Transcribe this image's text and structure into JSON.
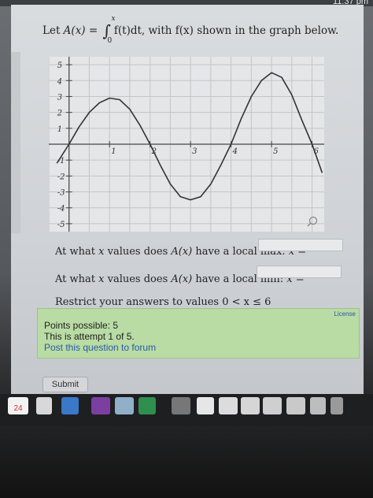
{
  "clock": "11:37 pm",
  "question": {
    "prefix": "Let ",
    "lhs": "A(x) = ",
    "int_upper": "x",
    "int_lower": "0",
    "integrand": "f(t)dt",
    "suffix": ", with f(x) shown in the graph below."
  },
  "chart_data": {
    "type": "line",
    "x_ticks": [
      "1",
      "2",
      "3",
      "4",
      "5",
      "6"
    ],
    "y_ticks": [
      "5",
      "4",
      "3",
      "2",
      "1",
      "-1",
      "-2",
      "-3",
      "-4",
      "-5"
    ],
    "xlim": [
      -0.5,
      6.3
    ],
    "ylim": [
      -5.5,
      5.5
    ],
    "grid": true,
    "series": [
      {
        "x": [
          -0.3,
          0,
          0.25,
          0.5,
          0.75,
          1,
          1.25,
          1.5,
          1.75,
          2,
          2.25,
          2.5,
          2.75,
          3,
          3.25,
          3.5,
          3.75,
          4,
          4.25,
          4.5,
          4.75,
          5,
          5.25,
          5.5,
          5.75,
          6,
          6.25
        ],
        "y": [
          -1.2,
          0,
          1.1,
          2,
          2.6,
          2.9,
          2.8,
          2.2,
          1.2,
          0,
          -1.3,
          -2.5,
          -3.3,
          -3.5,
          -3.3,
          -2.5,
          -1.3,
          0,
          1.6,
          3,
          4,
          4.5,
          4.2,
          3.1,
          1.5,
          0,
          -1.8
        ]
      }
    ]
  },
  "prompts": {
    "max": {
      "before": "At what ",
      "var": "x",
      "mid": " values does ",
      "fn": "A(x)",
      "after": " have a local max: ",
      "eq": "x ="
    },
    "min": {
      "before": "At what ",
      "var": "x",
      "mid": " values does ",
      "fn": "A(x)",
      "after": " have a local min: ",
      "eq": "x ="
    },
    "restrict": "Restrict your answers to values 0 < x ≤ 6"
  },
  "inputs": {
    "max_value": "",
    "min_value": ""
  },
  "info": {
    "points": "Points possible: 5",
    "attempt": "This is attempt 1 of 5.",
    "forum": "Post this question to forum",
    "license": "License"
  },
  "submit_label": "Submit",
  "dock": {
    "calendar_day": "24"
  }
}
